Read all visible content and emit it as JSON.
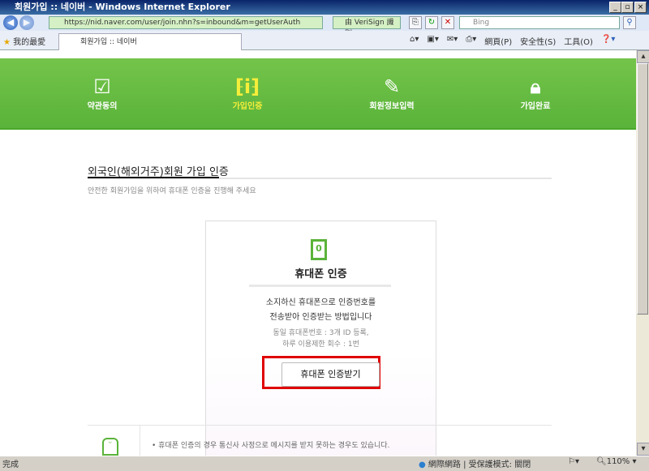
{
  "window": {
    "title": "회원가입 :: 네이버 - Windows Internet Explorer"
  },
  "browser": {
    "address": "https://nid.naver.com/user/join.nhn?s=inbound&m=getUserAuth",
    "cert": "由 VeriSign 識別",
    "search_placeholder": "Bing",
    "favorites": "我的最愛",
    "tab": "회원가입 :: 네이버",
    "menu": [
      "網頁(P)",
      "安全性(S)",
      "工具(O)"
    ],
    "status": "完成",
    "zone": "網際網路 | 受保護模式: 關閉",
    "zoom": "110%"
  },
  "steps": [
    {
      "label": "약관동의",
      "active": false
    },
    {
      "label": "가입인증",
      "active": true
    },
    {
      "label": "회원정보입력",
      "active": false
    },
    {
      "label": "가입완료",
      "active": false
    }
  ],
  "main": {
    "heading": "외국인(해외거주)회원 가입 인증",
    "subtitle": "안전한 회원가입을 위하여 휴대폰 인증을 진행해 주세요",
    "card": {
      "title": "휴대폰 인증",
      "desc1": "소지하신 휴대폰으로 인증번호를",
      "desc2": "전송받아 인증받는 방법입니다",
      "note1": "동일 휴대폰번호 : 3개 ID 등록,",
      "note2": "하루 이용제한 회수 : 1번",
      "button": "휴대폰 인증받기"
    },
    "notice": "휴대폰 인증의 경우 통신사 사정으로 메시지를 받지 못하는 경우도 있습니다."
  },
  "colors": {
    "green": "#5ab33a",
    "active": "#f5ee3a",
    "highlight": "#e00000"
  }
}
